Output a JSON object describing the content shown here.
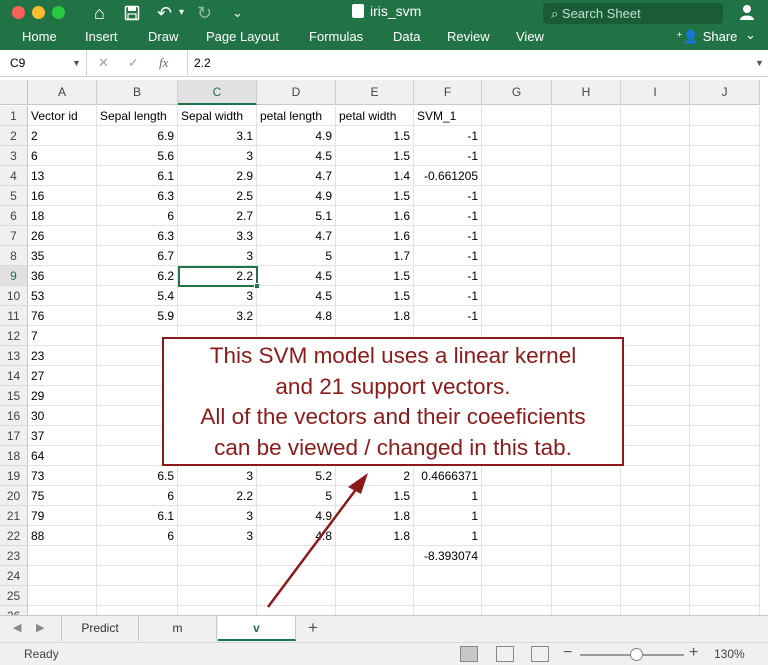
{
  "titlebar": {
    "filename": "iris_svm",
    "search_placeholder": "Search Sheet",
    "icons": [
      "home-icon",
      "save-icon",
      "undo-icon",
      "redo-icon",
      "customize-icon",
      "search-icon",
      "person-icon"
    ]
  },
  "ribbon": {
    "tabs": [
      "Home",
      "Insert",
      "Draw",
      "Page Layout",
      "Formulas",
      "Data",
      "Review",
      "View"
    ],
    "share_label": "Share"
  },
  "formula_bar": {
    "cell_ref": "C9",
    "fx_label": "fx",
    "value": "2.2"
  },
  "grid": {
    "columns": [
      "A",
      "B",
      "C",
      "D",
      "E",
      "F",
      "G",
      "H",
      "I",
      "J"
    ],
    "selected_column": "C",
    "selected_row": 9,
    "row_numbers": [
      "1",
      "2",
      "3",
      "4",
      "5",
      "6",
      "7",
      "8",
      "9",
      "10",
      "11",
      "12",
      "13",
      "14",
      "15",
      "16",
      "17",
      "18",
      "19",
      "20",
      "21",
      "22",
      "23",
      "24",
      "25",
      "26"
    ],
    "rows": [
      [
        "Vector id",
        "Sepal length",
        "Sepal width",
        "petal length",
        "petal width",
        "SVM_1"
      ],
      [
        "2",
        "6.9",
        "3.1",
        "4.9",
        "1.5",
        "-1"
      ],
      [
        "6",
        "5.6",
        "3",
        "4.5",
        "1.5",
        "-1"
      ],
      [
        "13",
        "6.1",
        "2.9",
        "4.7",
        "1.4",
        "-0.661205"
      ],
      [
        "16",
        "6.3",
        "2.5",
        "4.9",
        "1.5",
        "-1"
      ],
      [
        "18",
        "6",
        "2.7",
        "5.1",
        "1.6",
        "-1"
      ],
      [
        "26",
        "6.3",
        "3.3",
        "4.7",
        "1.6",
        "-1"
      ],
      [
        "35",
        "6.7",
        "3",
        "5",
        "1.7",
        "-1"
      ],
      [
        "36",
        "6.2",
        "2.2",
        "4.5",
        "1.5",
        "-1"
      ],
      [
        "53",
        "5.4",
        "3",
        "4.5",
        "1.5",
        "-1"
      ],
      [
        "76",
        "5.9",
        "3.2",
        "4.8",
        "1.8",
        "-1"
      ],
      [
        "7",
        "",
        "",
        "",
        "",
        ""
      ],
      [
        "23",
        "",
        "",
        "",
        "",
        ""
      ],
      [
        "27",
        "",
        "",
        "",
        "",
        ""
      ],
      [
        "29",
        "",
        "",
        "",
        "",
        ""
      ],
      [
        "30",
        "",
        "",
        "",
        "",
        ""
      ],
      [
        "37",
        "",
        "",
        "",
        "",
        ""
      ],
      [
        "64",
        "",
        "",
        "",
        "",
        ""
      ],
      [
        "73",
        "6.5",
        "3",
        "5.2",
        "2",
        "0.4666371"
      ],
      [
        "75",
        "6",
        "2.2",
        "5",
        "1.5",
        "1"
      ],
      [
        "79",
        "6.1",
        "3",
        "4.9",
        "1.8",
        "1"
      ],
      [
        "88",
        "6",
        "3",
        "4.8",
        "1.8",
        "1"
      ],
      [
        "",
        "",
        "",
        "",
        "",
        "-8.393074"
      ],
      [
        "",
        "",
        "",
        "",
        "",
        ""
      ],
      [
        "",
        "",
        "",
        "",
        "",
        ""
      ],
      [
        "",
        "",
        "",
        "",
        "",
        ""
      ]
    ]
  },
  "annotation": {
    "lines": [
      "This SVM model uses a linear kernel",
      "and 21 support vectors.",
      "All of the vectors and their coeeficients",
      "can be viewed / changed in this tab."
    ],
    "color": "#8b1a1a"
  },
  "sheet_tabs": {
    "tabs": [
      "Predict",
      "m",
      "v"
    ],
    "active": "v",
    "add_label": "+"
  },
  "status_bar": {
    "status": "Ready",
    "zoom": "130%",
    "zoom_fraction": 0.5
  },
  "colors": {
    "excel_green": "#217346",
    "annotation": "#8b1a1a"
  }
}
